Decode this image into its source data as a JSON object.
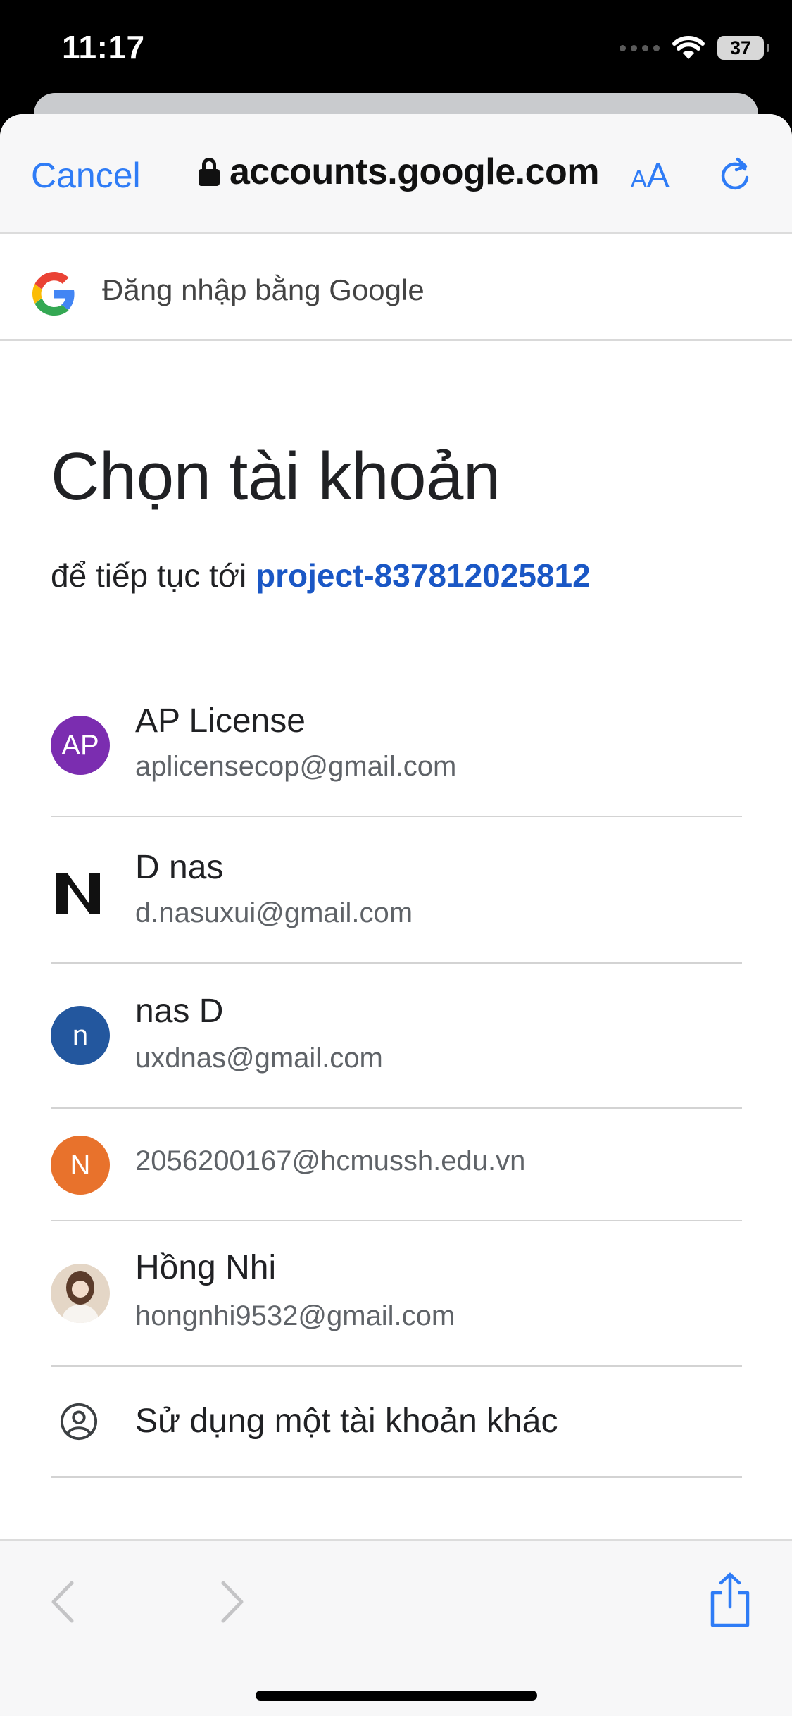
{
  "status": {
    "time": "11:17",
    "battery": "37"
  },
  "browser": {
    "cancel_label": "Cancel",
    "url": "accounts.google.com",
    "text_size_label_small": "A",
    "text_size_label_large": "A"
  },
  "google_header": {
    "text": "Đăng nhập bằng Google"
  },
  "page": {
    "title": "Chọn tài khoản",
    "subtitle_prefix": "để tiếp tục tới",
    "project": "project-837812025812"
  },
  "accounts": [
    {
      "initials": "AP",
      "name": "AP License",
      "email": "aplicensecop@gmail.com",
      "color": "#7b2db0"
    },
    {
      "initials": "N",
      "name": "D nas",
      "email": "d.nasuxui@gmail.com",
      "color": "#111111"
    },
    {
      "initials": "n",
      "name": "nas D",
      "email": "uxdnas@gmail.com",
      "color": "#23579e"
    },
    {
      "initials": "N",
      "name": "",
      "email": "2056200167@hcmussh.edu.vn",
      "color": "#e8722c"
    },
    {
      "initials": "",
      "name": "Hồng Nhi",
      "email": "hongnhi9532@gmail.com",
      "color": "#d9c3b0"
    }
  ],
  "other_account": {
    "label": "Sử dụng một tài khoản khác",
    "icon": "account-circle-icon"
  },
  "toolbar": {
    "back_icon": "chevron-left-icon",
    "forward_icon": "chevron-right-icon",
    "share_icon": "share-icon"
  }
}
